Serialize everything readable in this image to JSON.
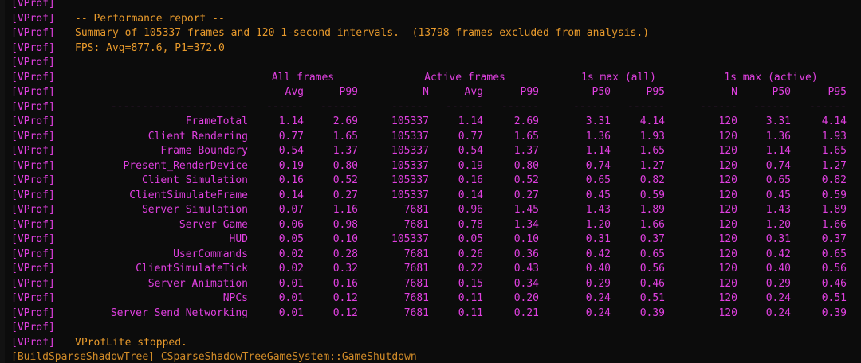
{
  "line_prefix": "[VProf]",
  "report_title": "-- Performance report --",
  "summary_line": "Summary of 105337 frames and 120 1-second intervals.  (13798 frames excluded from analysis.)",
  "fps_line": "FPS: Avg=877.6, P1=372.0",
  "group_headers": {
    "all_frames": "All frames",
    "active_frames": "Active frames",
    "max_all": "1s max (all)",
    "max_active": "1s max (active)"
  },
  "columns": [
    "Avg",
    "P99",
    "N",
    "Avg",
    "P99",
    "P50",
    "P95",
    "N",
    "P50",
    "P95"
  ],
  "dash_groups": [
    "----------------------",
    "------",
    "------",
    "------",
    "------",
    "------",
    "------",
    "------",
    "------",
    "------",
    "------"
  ],
  "rows": [
    {
      "name": "FrameTotal",
      "values": [
        "1.14",
        "2.69",
        "105337",
        "1.14",
        "2.69",
        "3.31",
        "4.14",
        "120",
        "3.31",
        "4.14"
      ]
    },
    {
      "name": "Client Rendering",
      "values": [
        "0.77",
        "1.65",
        "105337",
        "0.77",
        "1.65",
        "1.36",
        "1.93",
        "120",
        "1.36",
        "1.93"
      ]
    },
    {
      "name": "Frame Boundary",
      "values": [
        "0.54",
        "1.37",
        "105337",
        "0.54",
        "1.37",
        "1.14",
        "1.65",
        "120",
        "1.14",
        "1.65"
      ]
    },
    {
      "name": "Present_RenderDevice",
      "values": [
        "0.19",
        "0.80",
        "105337",
        "0.19",
        "0.80",
        "0.74",
        "1.27",
        "120",
        "0.74",
        "1.27"
      ]
    },
    {
      "name": "Client Simulation",
      "values": [
        "0.16",
        "0.52",
        "105337",
        "0.16",
        "0.52",
        "0.65",
        "0.82",
        "120",
        "0.65",
        "0.82"
      ]
    },
    {
      "name": "ClientSimulateFrame",
      "values": [
        "0.14",
        "0.27",
        "105337",
        "0.14",
        "0.27",
        "0.45",
        "0.59",
        "120",
        "0.45",
        "0.59"
      ]
    },
    {
      "name": "Server Simulation",
      "values": [
        "0.07",
        "1.16",
        "7681",
        "0.96",
        "1.45",
        "1.43",
        "1.89",
        "120",
        "1.43",
        "1.89"
      ]
    },
    {
      "name": "Server Game",
      "values": [
        "0.06",
        "0.98",
        "7681",
        "0.78",
        "1.34",
        "1.20",
        "1.66",
        "120",
        "1.20",
        "1.66"
      ]
    },
    {
      "name": "HUD",
      "values": [
        "0.05",
        "0.10",
        "105337",
        "0.05",
        "0.10",
        "0.31",
        "0.37",
        "120",
        "0.31",
        "0.37"
      ]
    },
    {
      "name": "UserCommands",
      "values": [
        "0.02",
        "0.28",
        "7681",
        "0.26",
        "0.36",
        "0.42",
        "0.65",
        "120",
        "0.42",
        "0.65"
      ]
    },
    {
      "name": "ClientSimulateTick",
      "values": [
        "0.02",
        "0.32",
        "7681",
        "0.22",
        "0.43",
        "0.40",
        "0.56",
        "120",
        "0.40",
        "0.56"
      ]
    },
    {
      "name": "Server Animation",
      "values": [
        "0.01",
        "0.16",
        "7681",
        "0.15",
        "0.34",
        "0.29",
        "0.46",
        "120",
        "0.29",
        "0.46"
      ]
    },
    {
      "name": "NPCs",
      "values": [
        "0.01",
        "0.12",
        "7681",
        "0.11",
        "0.20",
        "0.24",
        "0.51",
        "120",
        "0.24",
        "0.51"
      ]
    },
    {
      "name": "Server Send Networking",
      "values": [
        "0.01",
        "0.12",
        "7681",
        "0.11",
        "0.21",
        "0.24",
        "0.39",
        "120",
        "0.24",
        "0.39"
      ]
    }
  ],
  "stopped_line": "VProfLite stopped.",
  "trailing_line": "[BuildSparseShadowTree] CSparseShadowTreeGameSystem::GameShutdown",
  "colors": {
    "background": "#0c0c0c",
    "magenta": "#e040e0",
    "orange": "#e89a2c"
  }
}
